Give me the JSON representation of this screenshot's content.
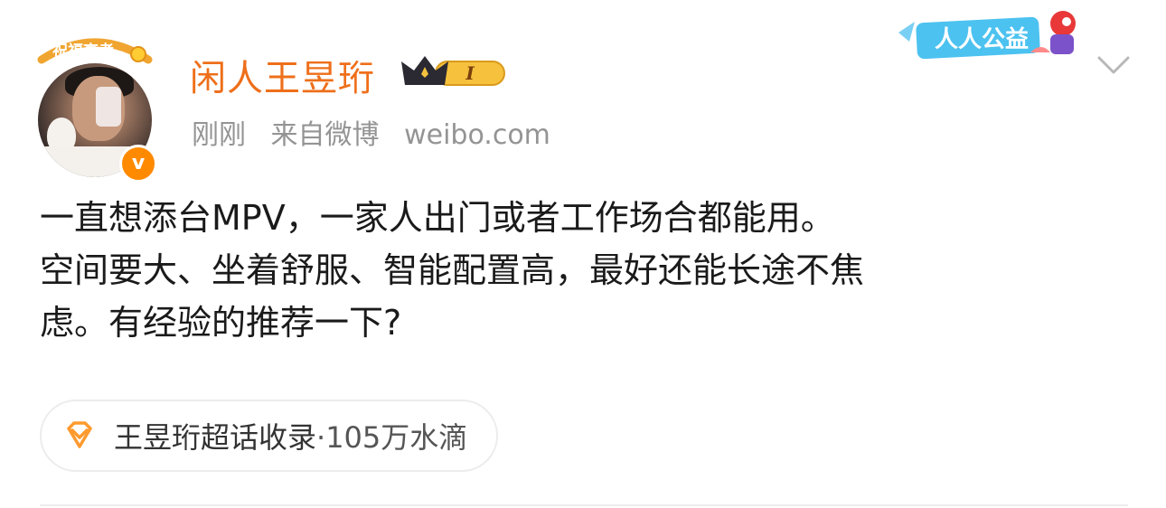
{
  "post": {
    "exam_badge_text": "祝福高考",
    "username": "闲人王昱珩",
    "vip_level": "I",
    "time": "刚刚",
    "source": "来自微博",
    "domain": "weibo.com",
    "charity_label": "人人公益",
    "content_lines": [
      "一直想添台MPV，一家人出门或者工作场合都能用。",
      "空间要大、坐着舒服、智能配置高，最好还能长途不焦",
      "虑。有经验的推荐一下?"
    ],
    "topic": {
      "label": "王昱珩超话收录",
      "stat": "·105万水滴"
    }
  },
  "colors": {
    "username": "#ee6f1a",
    "meta_gray": "#949494",
    "verified_orange": "#ff8a00",
    "vip_gold": "#f6c23e",
    "diamond_orange": "#ff9a2e"
  },
  "icons": [
    "exam-blessing-icon",
    "verified-icon",
    "vip-crown-icon",
    "charity-icon",
    "chevron-down-icon",
    "supertopic-diamond-icon"
  ]
}
